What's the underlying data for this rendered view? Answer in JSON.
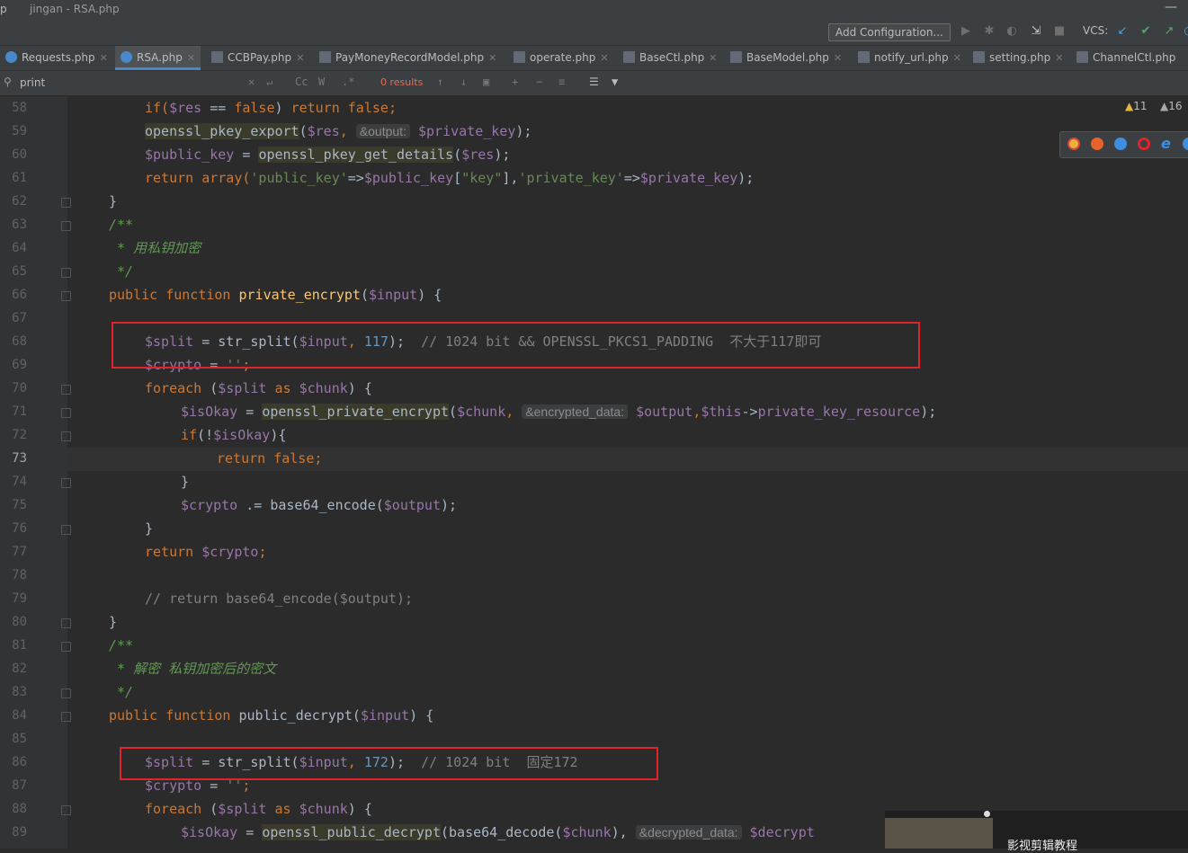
{
  "window": {
    "title_left": "p",
    "title": "jingan - RSA.php",
    "minimize": "—"
  },
  "toolbar": {
    "add_configuration": "Add Configuration...",
    "vcs_label": "VCS:"
  },
  "tabs": [
    {
      "label": "Requests.php",
      "icon": "class-icon"
    },
    {
      "label": "RSA.php",
      "icon": "class-icon",
      "active": true
    },
    {
      "label": "CCBPay.php",
      "icon": "php-file-icon"
    },
    {
      "label": "PayMoneyRecordModel.php",
      "icon": "php-file-icon"
    },
    {
      "label": "operate.php",
      "icon": "php-file-icon"
    },
    {
      "label": "BaseCtl.php",
      "icon": "php-file-icon"
    },
    {
      "label": "BaseModel.php",
      "icon": "php-file-icon"
    },
    {
      "label": "notify_url.php",
      "icon": "php-file-icon"
    },
    {
      "label": "setting.php",
      "icon": "php-file-icon"
    },
    {
      "label": "ChannelCtl.php",
      "icon": "php-file-icon"
    }
  ],
  "search": {
    "query": "print",
    "results": "0 results",
    "match_case": "Cc",
    "words": "W",
    "regex": ".*"
  },
  "inspections": {
    "warnings": "11",
    "weak_warnings": "16"
  },
  "line_numbers": [
    "58",
    "59",
    "60",
    "61",
    "62",
    "63",
    "64",
    "65",
    "66",
    "67",
    "68",
    "69",
    "70",
    "71",
    "72",
    "73",
    "74",
    "75",
    "76",
    "77",
    "78",
    "79",
    "80",
    "81",
    "82",
    "83",
    "84",
    "85",
    "86",
    "87",
    "88",
    "89"
  ],
  "current_line": "73",
  "code": {
    "l58": [
      "if(",
      "$res",
      " == ",
      "false",
      ") ",
      "return",
      " ",
      "false",
      ";"
    ],
    "l59": [
      "openssl_pkey_export",
      "(",
      "$res",
      ", ",
      "&output:",
      " ",
      "$private_key",
      ");"
    ],
    "l60": [
      "$public_key",
      " = ",
      "openssl_pkey_get_details",
      "(",
      "$res",
      ");"
    ],
    "l61": [
      "return",
      " array(",
      "'public_key'",
      "=>",
      "$public_key",
      "[",
      "\"key\"",
      "],",
      "'private_key'",
      "=>",
      "$private_key",
      ");"
    ],
    "l62": "}",
    "l63": "/**",
    "l64": " * 用私钥加密",
    "l65": " */",
    "l66": [
      "public",
      " ",
      "function",
      " ",
      "private_encrypt",
      "(",
      "$input",
      ") {"
    ],
    "l68": [
      "$split",
      " = str_split(",
      "$input",
      ", ",
      "117",
      ");  ",
      "// 1024 bit && OPENSSL_PKCS1_PADDING  不大于117即可"
    ],
    "l69": [
      "$crypto",
      " = ",
      "''",
      ";"
    ],
    "l70": [
      "foreach",
      " (",
      "$split",
      " ",
      "as",
      " ",
      "$chunk",
      ") {"
    ],
    "l71": [
      "$isOkay",
      " = ",
      "openssl_private_encrypt",
      "(",
      "$chunk",
      ", ",
      "&encrypted_data:",
      " ",
      "$output",
      ",",
      "$this",
      "->",
      "private_key_resource",
      ");"
    ],
    "l72": [
      "if",
      "(!",
      "$isOkay",
      "){"
    ],
    "l73": [
      "return",
      " ",
      "false",
      ";"
    ],
    "l74": "}",
    "l75": [
      "$crypto",
      " .= base64_encode(",
      "$output",
      ");"
    ],
    "l76": "}",
    "l77": [
      "return",
      " ",
      "$crypto",
      ";"
    ],
    "l79": "// return base64_encode($output);",
    "l80": "}",
    "l81": "/**",
    "l82": " * 解密 私钥加密后的密文",
    "l83": " */",
    "l84": [
      "public",
      " ",
      "function",
      " public_decrypt(",
      "$input",
      ") {"
    ],
    "l86": [
      "$split",
      " = str_split(",
      "$input",
      ", ",
      "172",
      ");  ",
      "// 1024 bit  固定172"
    ],
    "l87": [
      "$crypto",
      " = ",
      "''",
      ";"
    ],
    "l88": [
      "foreach",
      " (",
      "$split",
      " ",
      "as",
      " ",
      "$chunk",
      ") {"
    ],
    "l89": [
      "$isOkay",
      " = ",
      "openssl_public_decrypt",
      "(base64_decode(",
      "$chunk",
      "), ",
      "&decrypted_data:",
      " ",
      "$decrypt"
    ]
  },
  "video_thumb": {
    "title": "影视剪辑教程"
  },
  "colors": {
    "editor_bg": "#2b2b2b",
    "keyword": "#cc7832",
    "variable": "#9876aa",
    "string": "#6a8759",
    "number": "#6897bb",
    "highlight_box": "#e0242b"
  }
}
